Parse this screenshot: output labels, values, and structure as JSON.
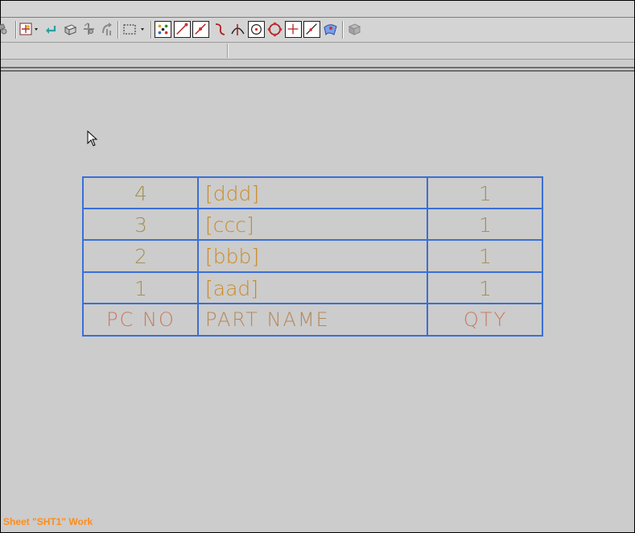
{
  "toolbar": {
    "items": [
      {
        "icon": "partial-view-icon",
        "pressed": false
      },
      {
        "icon": "snap-grid-dropdown-icon",
        "pressed": false
      },
      {
        "icon": "return-arrow-icon",
        "pressed": false
      },
      {
        "icon": "part-view-icon",
        "pressed": false
      },
      {
        "icon": "move-tool-icon",
        "pressed": false
      },
      {
        "icon": "rotate-tool-icon",
        "pressed": false
      },
      {
        "icon": "select-box-dropdown-icon",
        "pressed": false
      },
      {
        "icon": "snap-points-icon",
        "pressed": true
      },
      {
        "icon": "snap-endpoint-icon",
        "pressed": true
      },
      {
        "icon": "snap-midpoint-icon",
        "pressed": true
      },
      {
        "icon": "snap-control-icon",
        "pressed": false
      },
      {
        "icon": "snap-intersection-icon",
        "pressed": false
      },
      {
        "icon": "snap-center-icon",
        "pressed": true
      },
      {
        "icon": "snap-quadrant-icon",
        "pressed": false
      },
      {
        "icon": "snap-existing-point-icon",
        "pressed": true
      },
      {
        "icon": "snap-point-on-curve-icon",
        "pressed": true
      },
      {
        "icon": "snap-point-on-surface-icon",
        "pressed": false
      },
      {
        "icon": "view-3d-icon",
        "pressed": false
      }
    ]
  },
  "bom_table": {
    "rows": [
      {
        "pc_no": "4",
        "part_name": "[ddd]",
        "qty": "1"
      },
      {
        "pc_no": "3",
        "part_name": "[ccc]",
        "qty": "1"
      },
      {
        "pc_no": "2",
        "part_name": "[bbb]",
        "qty": "1"
      },
      {
        "pc_no": "1",
        "part_name": "[aad]",
        "qty": "1"
      }
    ],
    "header": {
      "pc_no": "PC NO",
      "part_name": "PART NAME",
      "qty": "QTY"
    },
    "colors": {
      "grid": "#3a6fd6",
      "text_olive": "#a49052",
      "text_orange": "#cc8a22",
      "header_text": "#c87a5e"
    }
  },
  "status_bar": {
    "text": "Sheet \"SHT1\" Work",
    "color": "#ff8c1a"
  }
}
